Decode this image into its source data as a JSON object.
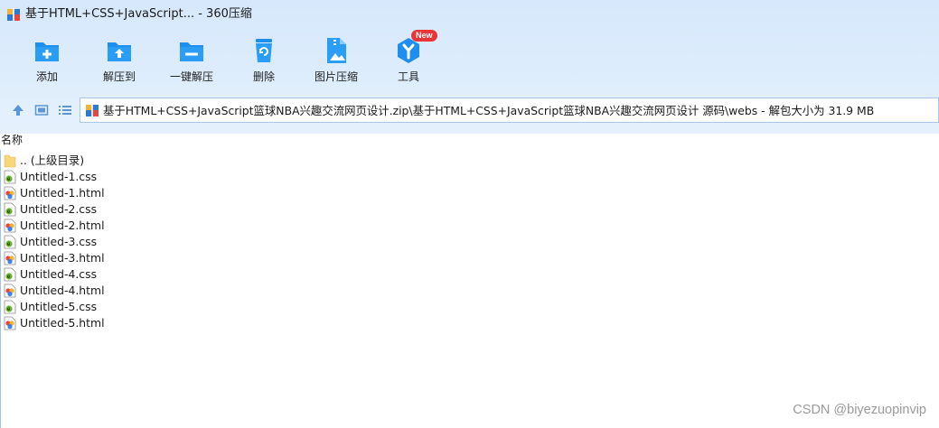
{
  "window": {
    "title": "基于HTML+CSS+JavaScript... - 360压缩"
  },
  "toolbar": {
    "items": [
      {
        "label": "添加",
        "icon": "add-file-icon"
      },
      {
        "label": "解压到",
        "icon": "extract-to-icon"
      },
      {
        "label": "一键解压",
        "icon": "one-click-extract-icon"
      },
      {
        "label": "删除",
        "icon": "delete-icon"
      },
      {
        "label": "图片压缩",
        "icon": "image-compress-icon"
      },
      {
        "label": "工具",
        "icon": "tools-icon",
        "badge": "New"
      }
    ]
  },
  "address": {
    "path": "基于HTML+CSS+JavaScript篮球NBA兴趣交流网页设计.zip\\基于HTML+CSS+JavaScript篮球NBA兴趣交流网页设计 源码\\webs - 解包大小为 31.9 MB"
  },
  "list": {
    "column_name": "名称",
    "items": [
      {
        "name": ".. (上级目录)",
        "type": "folder"
      },
      {
        "name": "Untitled-1.css",
        "type": "css"
      },
      {
        "name": "Untitled-1.html",
        "type": "html"
      },
      {
        "name": "Untitled-2.css",
        "type": "css"
      },
      {
        "name": "Untitled-2.html",
        "type": "html"
      },
      {
        "name": "Untitled-3.css",
        "type": "css"
      },
      {
        "name": "Untitled-3.html",
        "type": "html"
      },
      {
        "name": "Untitled-4.css",
        "type": "css"
      },
      {
        "name": "Untitled-4.html",
        "type": "html"
      },
      {
        "name": "Untitled-5.css",
        "type": "css"
      },
      {
        "name": "Untitled-5.html",
        "type": "html"
      }
    ]
  },
  "watermark": "CSDN @biyezuopinvip",
  "colors": {
    "toolbar_bg": "#d6e8fb",
    "icon_blue": "#1e8ff0",
    "badge_red": "#e8353a",
    "folder_yellow": "#f7d77a"
  }
}
